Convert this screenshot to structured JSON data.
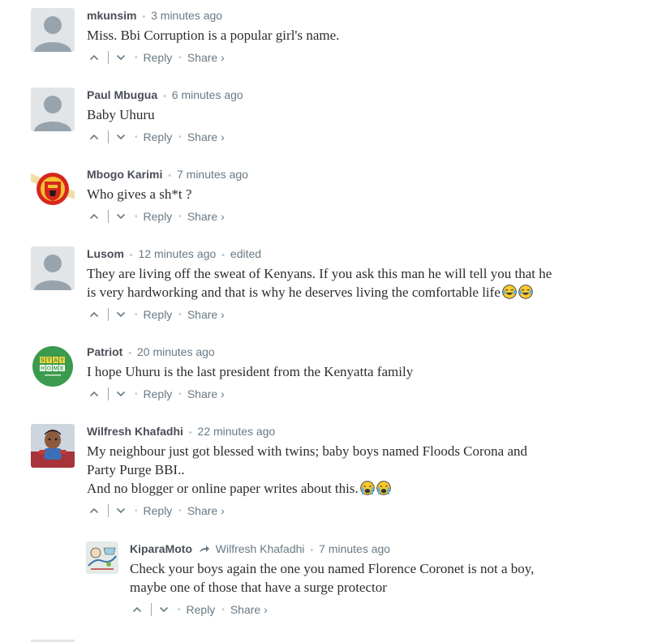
{
  "comments": [
    {
      "author": "mkunsim",
      "time": "3 minutes ago",
      "lines": [
        "Miss. Bbi Corruption is a popular girl's name."
      ],
      "avatar": "default-avatar"
    },
    {
      "author": "Paul Mbugua",
      "time": "6 minutes ago",
      "lines": [
        "Baby Uhuru"
      ],
      "avatar": "default-avatar"
    },
    {
      "author": "Mbogo Karimi",
      "time": "7 minutes ago",
      "lines": [
        "Who gives a sh*t ?"
      ],
      "avatar": "club-crest-avatar"
    },
    {
      "author": "Lusom",
      "time": "12 minutes ago",
      "edited": "edited",
      "lines": [
        "They are living off the sweat of Kenyans. If you ask this man he will tell you that he",
        "is very hardworking and that is why he deserves living the comfortable life"
      ],
      "emoji": [
        "tears-of-joy",
        "tears-of-joy"
      ],
      "avatar": "default-avatar"
    },
    {
      "author": "Patriot",
      "time": "20 minutes ago",
      "lines": [
        "I hope Uhuru is the last president from the Kenyatta family"
      ],
      "avatar": "stay-home-avatar",
      "avatar_text": [
        "S",
        "T",
        "A",
        "Y",
        "H",
        "O",
        "M",
        "E"
      ]
    },
    {
      "author": "Wilfresh Khafadhi",
      "time": "22 minutes ago",
      "lines": [
        "My neighbour just got blessed with twins; baby boys named Floods Corona and",
        "Party Purge BBI..",
        "And no blogger or online paper writes about this."
      ],
      "emoji": [
        "crying-face",
        "crying-face"
      ],
      "avatar": "child-photo-avatar"
    },
    {
      "author": "KiparaMoto",
      "reply_to": "Wilfresh Khafadhi",
      "time": "7 minutes ago",
      "lines": [
        "Check your boys again the one you named Florence Coronet is not a boy,",
        "maybe one of those that have a surge protector"
      ],
      "avatar": "cartoon-avatar"
    }
  ],
  "actions": {
    "reply": "Reply",
    "share": "Share ›"
  },
  "colors": {
    "author": "#494e58",
    "meta": "#687a86",
    "text": "#2a2e2e",
    "avatar_bg": "#e1e5e8",
    "stay_home_green": "#3a9b4e"
  }
}
